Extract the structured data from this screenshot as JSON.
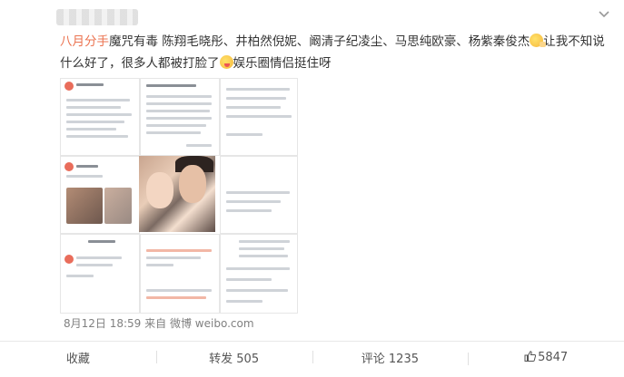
{
  "post": {
    "text_topic": "八月分手",
    "text_part1": "魔咒有毒 陈翔毛晓彤、井柏然倪妮、阚清子纪凌尘、马思纯欧豪、杨紫秦俊杰",
    "text_part2": "让我不知说什么好了，很多人都被打脸了",
    "text_part3": "娱乐圈情侣挺住呀",
    "emoji_1": "hand-over-mouth-emoji",
    "emoji_2": "tongue-out-emoji",
    "timestamp": "8月12日 18:59",
    "source_prefix": "来自",
    "source": "微博 weibo.com"
  },
  "actions": {
    "favorite_label": "收藏",
    "repost_label": "转发 505",
    "comment_label": "评论 1235",
    "like_count": "5847"
  },
  "colors": {
    "topic": "#eb7350",
    "meta": "#808080",
    "text": "#333333"
  }
}
